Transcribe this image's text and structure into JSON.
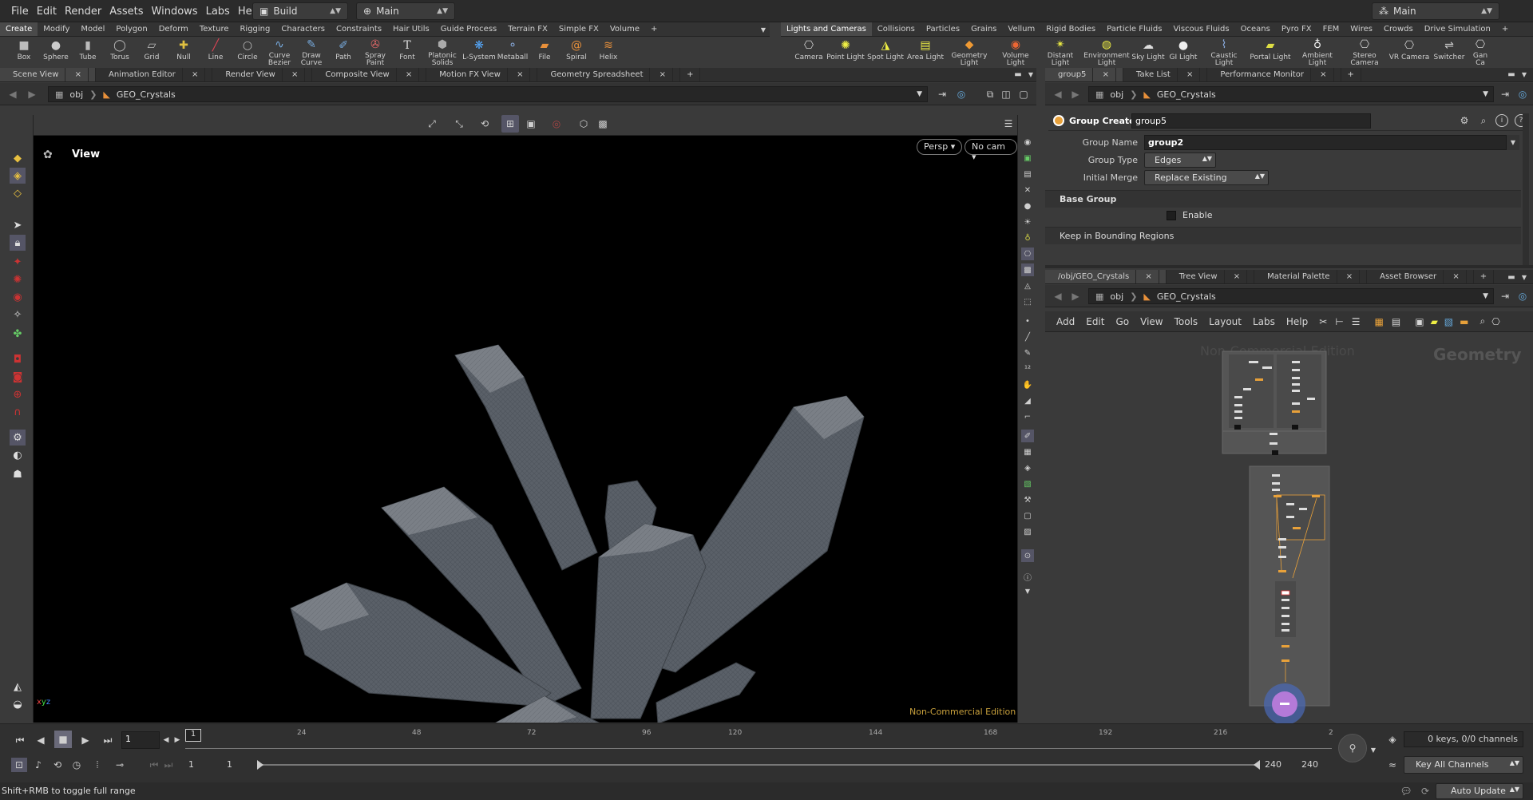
{
  "menubar": {
    "menus": [
      "File",
      "Edit",
      "Render",
      "Assets",
      "Windows",
      "Labs",
      "Help"
    ],
    "desktop": "Build",
    "context": "Main",
    "right_desktop": "Main"
  },
  "shelf_left": {
    "tabs": [
      "Create",
      "Modify",
      "Model",
      "Polygon",
      "Deform",
      "Texture",
      "Rigging",
      "Characters",
      "Constraints",
      "Hair Utils",
      "Guide Process",
      "Terrain FX",
      "Simple FX",
      "Volume",
      "+"
    ],
    "tools": [
      "Box",
      "Sphere",
      "Tube",
      "Torus",
      "Grid",
      "Null",
      "Line",
      "Circle",
      "Curve Bezier",
      "Draw Curve",
      "Path",
      "Spray Paint",
      "Font",
      "Platonic Solids",
      "L-System",
      "Metaball",
      "File",
      "Spiral",
      "Helix"
    ]
  },
  "shelf_right": {
    "tabs": [
      "Lights and Cameras",
      "Collisions",
      "Particles",
      "Grains",
      "Vellum",
      "Rigid Bodies",
      "Particle Fluids",
      "Viscous Fluids",
      "Oceans",
      "Pyro FX",
      "FEM",
      "Wires",
      "Crowds",
      "Drive Simulation",
      "+"
    ],
    "tools": [
      "Camera",
      "Point Light",
      "Spot Light",
      "Area Light",
      "Geometry Light",
      "Volume Light",
      "Distant Light",
      "Environment Light",
      "Sky Light",
      "GI Light",
      "Caustic Light",
      "Portal Light",
      "Ambient Light",
      "Stereo Camera",
      "VR Camera",
      "Switcher",
      "Gan Ca"
    ]
  },
  "left_pane": {
    "tabs": [
      "Scene View",
      "Animation Editor",
      "Render View",
      "Composite View",
      "Motion FX View",
      "Geometry Spreadsheet",
      "+"
    ],
    "path_root": "obj",
    "path_node": "GEO_Crystals"
  },
  "viewport": {
    "title": "View",
    "persp": "Persp",
    "cam": "No cam",
    "watermark": "Non-Commercial Edition",
    "axis": "x y z"
  },
  "right_top": {
    "tabs": [
      "group5",
      "Take List",
      "Performance Monitor",
      "+"
    ],
    "path_root": "obj",
    "path_node": "GEO_Crystals",
    "node_type": "Group Create",
    "node_name": "group5",
    "params": {
      "group_name_label": "Group Name",
      "group_name": "group2",
      "group_type_label": "Group Type",
      "group_type": "Edges",
      "initial_merge_label": "Initial Merge",
      "initial_merge": "Replace Existing",
      "base_group": "Base Group",
      "enable": "Enable",
      "keep_bounding": "Keep in Bounding Regions"
    }
  },
  "network": {
    "tabs": [
      "/obj/GEO_Crystals",
      "Tree View",
      "Material Palette",
      "Asset Browser",
      "+"
    ],
    "path_root": "obj",
    "path_node": "GEO_Crystals",
    "menus": [
      "Add",
      "Edit",
      "Go",
      "View",
      "Tools",
      "Layout",
      "Labs",
      "Help"
    ],
    "watermark": "Non-Commercial Edition",
    "context_label": "Geometry"
  },
  "timeline": {
    "ticks": [
      "24",
      "48",
      "72",
      "96",
      "120",
      "144",
      "168",
      "192",
      "216",
      "2"
    ],
    "current_frame": "1",
    "frame_marker": "1",
    "start": "1",
    "start2": "1",
    "end": "240",
    "end2": "240",
    "keys": "0 keys, 0/0 channels",
    "key_all": "Key All Channels",
    "auto_update": "Auto Update"
  },
  "status": {
    "text": "Shift+RMB to toggle full range"
  },
  "colors": {
    "accent_orange": "#e8a13a",
    "bg_dark": "#2b2b2b",
    "viewport_bg": "#000000",
    "watermark": "#c8a03c"
  }
}
